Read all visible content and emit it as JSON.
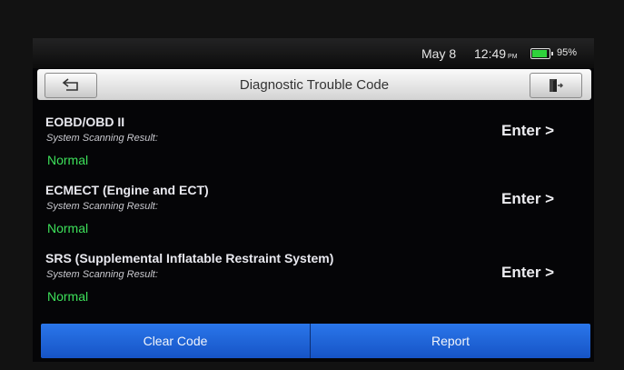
{
  "status_bar": {
    "date": "May 8",
    "time": "12:49",
    "meridiem": "PM",
    "battery_percent": "95%",
    "battery_level": 0.95,
    "battery_color": "#2fd23c"
  },
  "header": {
    "title": "Diagnostic Trouble Code",
    "back_icon": "back-arrow-icon",
    "exit_icon": "exit-door-icon"
  },
  "systems": [
    {
      "name": "EOBD/OBD II",
      "scan_label": "System Scanning Result:",
      "status": "Normal",
      "action": "Enter >"
    },
    {
      "name": "ECMECT (Engine and ECT)",
      "scan_label": "System Scanning Result:",
      "status": "Normal",
      "action": "Enter >"
    },
    {
      "name": "SRS (Supplemental Inflatable Restraint System)",
      "scan_label": "System Scanning Result:",
      "status": "Normal",
      "action": "Enter >"
    }
  ],
  "footer": {
    "clear_code": "Clear Code",
    "report": "Report"
  },
  "colors": {
    "accent_blue": "#1f64d8",
    "status_normal": "#3de05a"
  }
}
